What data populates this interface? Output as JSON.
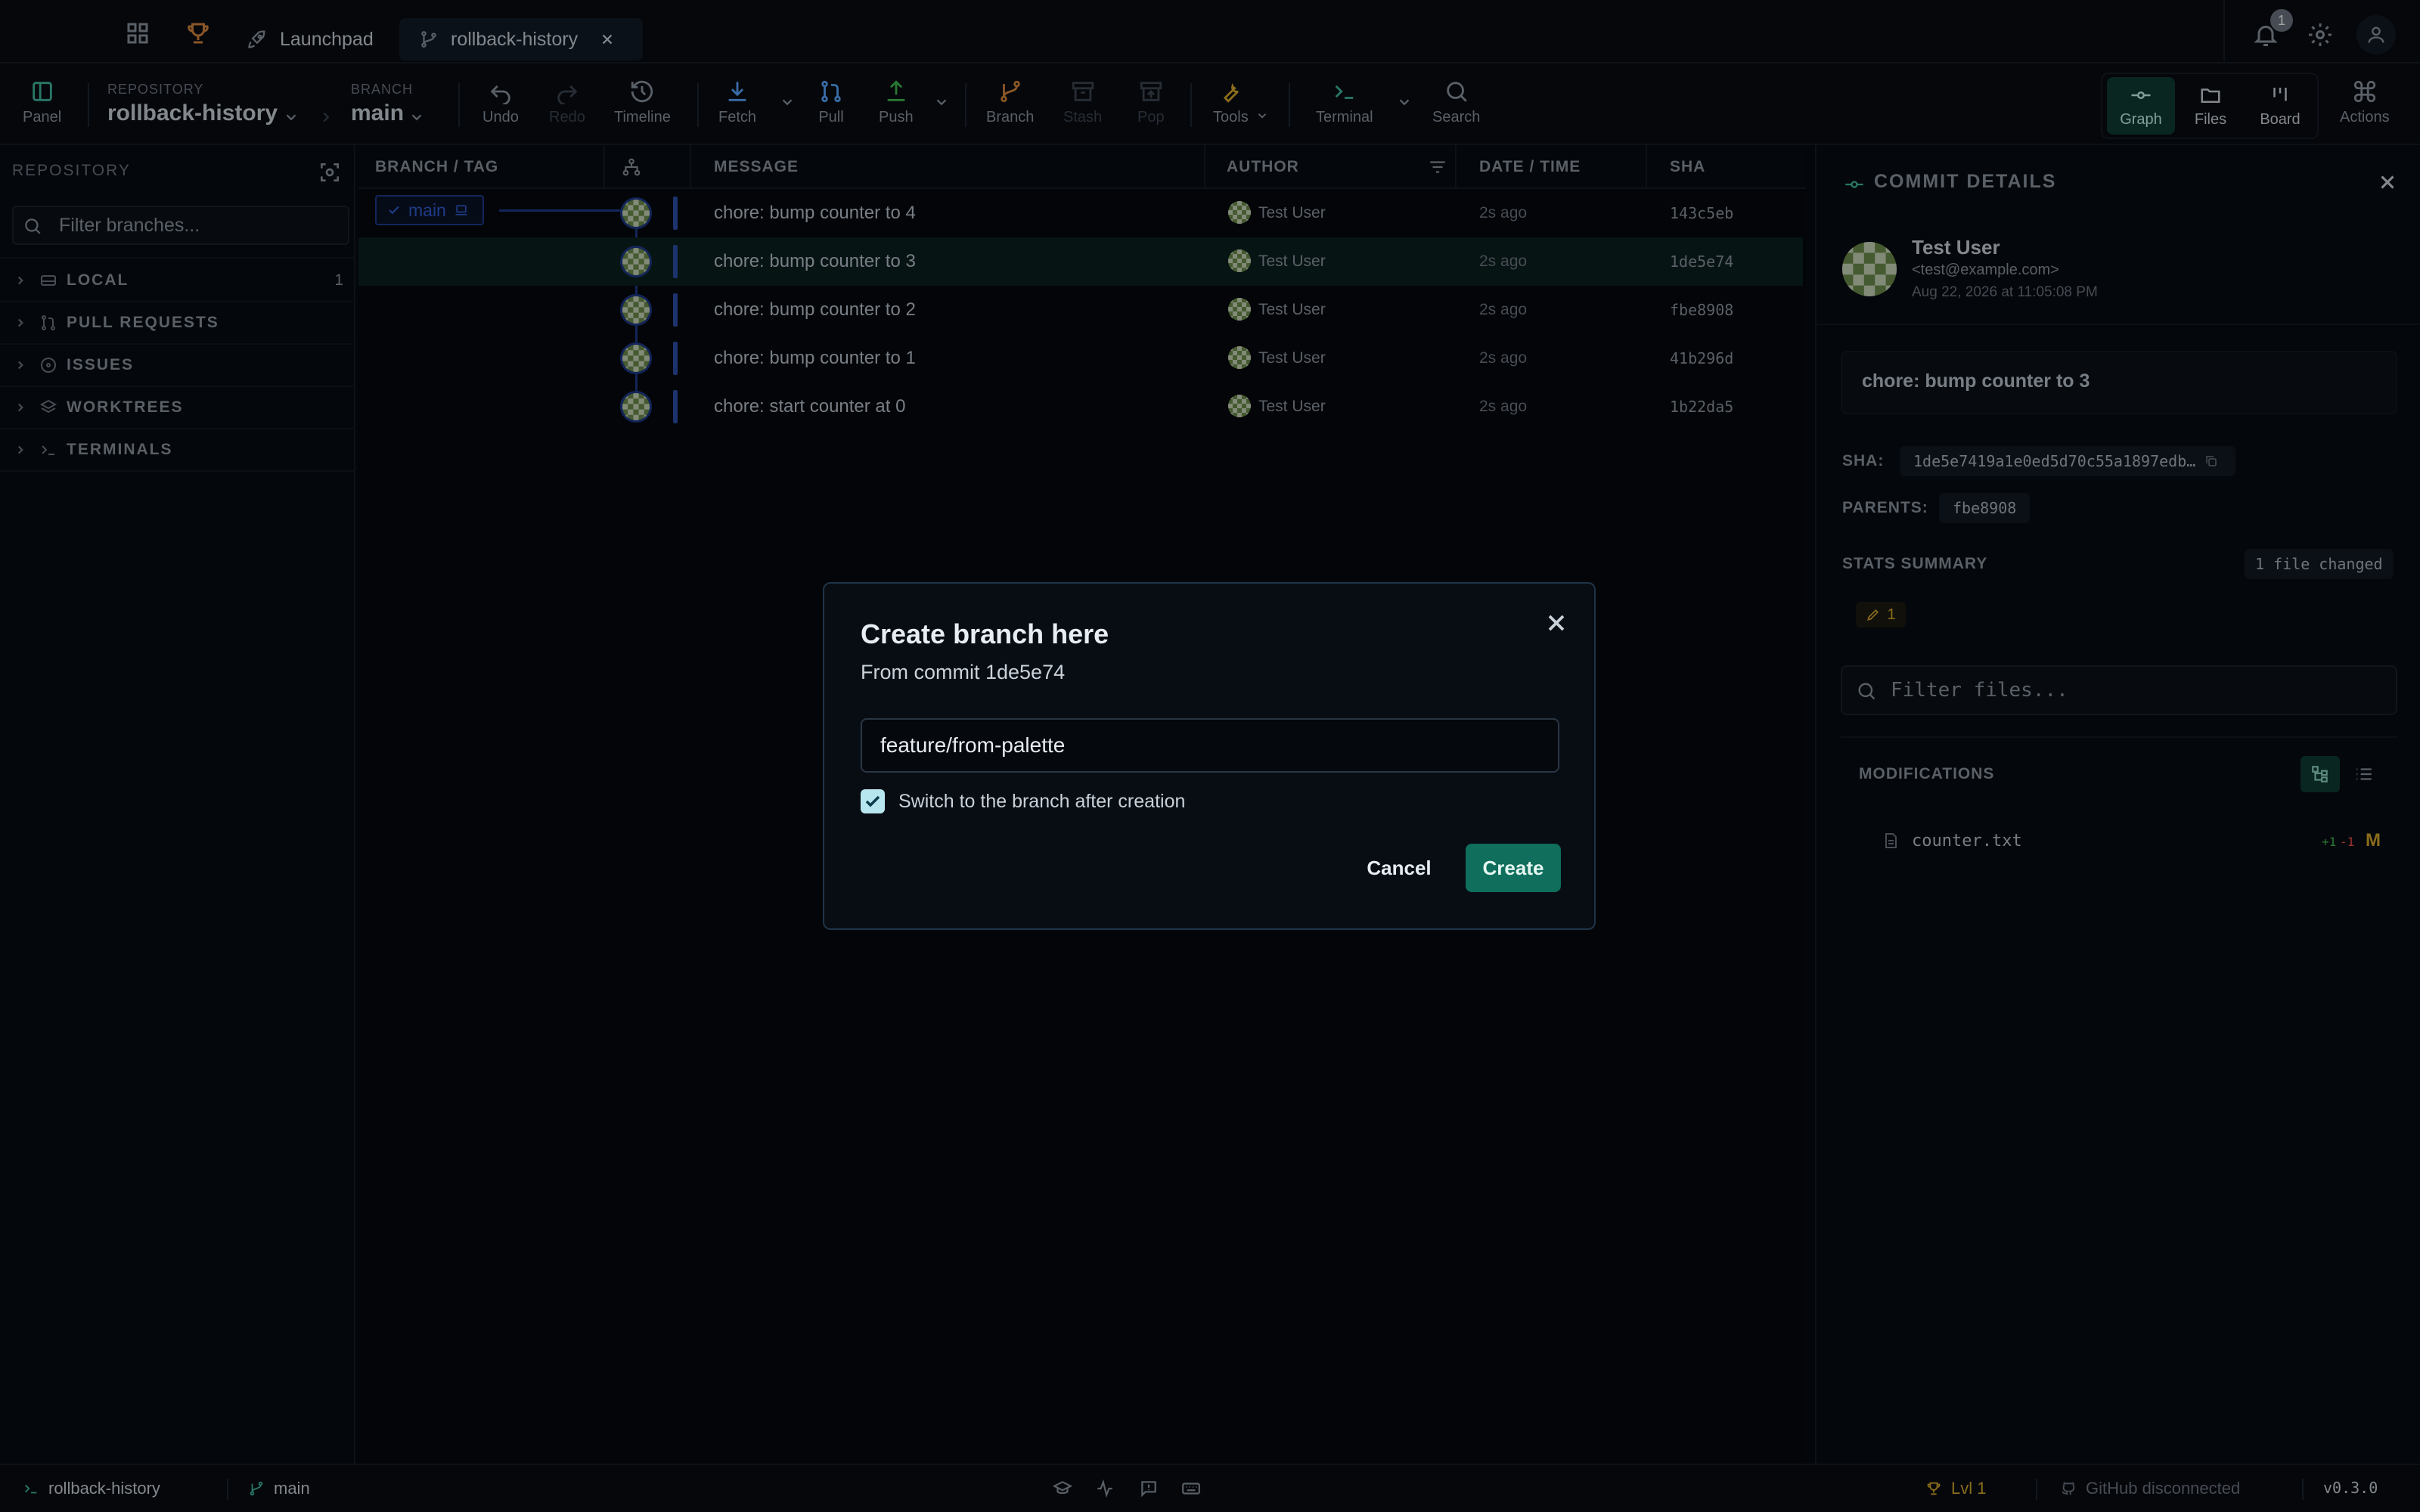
{
  "tabs": {
    "launchpad_label": "Launchpad",
    "repo_tab_label": "rollback-history",
    "notification_count": "1"
  },
  "toolbar": {
    "panel_label": "Panel",
    "repository_caption": "REPOSITORY",
    "repository_name": "rollback-history",
    "branch_caption": "BRANCH",
    "branch_name": "main",
    "undo": "Undo",
    "redo": "Redo",
    "timeline": "Timeline",
    "fetch": "Fetch",
    "pull": "Pull",
    "push": "Push",
    "branch": "Branch",
    "stash": "Stash",
    "pop": "Pop",
    "tools": "Tools",
    "terminal": "Terminal",
    "search": "Search",
    "graph": "Graph",
    "files": "Files",
    "board": "Board",
    "actions": "Actions"
  },
  "sidebar": {
    "title": "REPOSITORY",
    "filter_placeholder": "Filter branches...",
    "items": [
      {
        "label": "LOCAL",
        "count": "1"
      },
      {
        "label": "PULL REQUESTS",
        "count": ""
      },
      {
        "label": "ISSUES",
        "count": ""
      },
      {
        "label": "WORKTREES",
        "count": ""
      },
      {
        "label": "TERMINALS",
        "count": ""
      }
    ]
  },
  "graph": {
    "columns": {
      "branch_tag": "BRANCH / TAG",
      "message": "MESSAGE",
      "author": "AUTHOR",
      "date_time": "DATE / TIME",
      "sha": "SHA"
    },
    "branch_label": "main",
    "commits": [
      {
        "message": "chore: bump counter to 4",
        "author": "Test User",
        "date": "2s ago",
        "sha": "143c5eb"
      },
      {
        "message": "chore: bump counter to 3",
        "author": "Test User",
        "date": "2s ago",
        "sha": "1de5e74"
      },
      {
        "message": "chore: bump counter to 2",
        "author": "Test User",
        "date": "2s ago",
        "sha": "fbe8908"
      },
      {
        "message": "chore: bump counter to 1",
        "author": "Test User",
        "date": "2s ago",
        "sha": "41b296d"
      },
      {
        "message": "chore: start counter at 0",
        "author": "Test User",
        "date": "2s ago",
        "sha": "1b22da5"
      }
    ],
    "selected_index": 1
  },
  "details": {
    "title": "COMMIT DETAILS",
    "author_name": "Test User",
    "author_email": "<test@example.com>",
    "author_date": "Aug 22, 2026 at 11:05:08 PM",
    "commit_message": "chore: bump counter to 3",
    "sha_label": "SHA:",
    "sha_value": "1de5e7419a1e0ed5d70c55a1897edb…",
    "parents_label": "PARENTS:",
    "parent_sha": "fbe8908",
    "stats_label": "STATS SUMMARY",
    "files_changed": "1 file changed",
    "modified_count": "1",
    "filter_placeholder": "Filter files...",
    "modifications_label": "MODIFICATIONS",
    "files": [
      {
        "name": "counter.txt",
        "additions": "+1",
        "deletions": "-1",
        "status": "M"
      }
    ]
  },
  "statusbar": {
    "repo": "rollback-history",
    "branch": "main",
    "level": "Lvl 1",
    "github": "GitHub disconnected",
    "version": "v0.3.0"
  },
  "modal": {
    "title": "Create branch here",
    "subtitle": "From commit 1de5e74",
    "input_value": "feature/from-palette",
    "checkbox_label": "Switch to the branch after creation",
    "checkbox_checked": true,
    "cancel_label": "Cancel",
    "create_label": "Create"
  },
  "colors": {
    "accent": "#0f6e5c",
    "lane": "#2b4fa8",
    "warning": "#d4a72c",
    "add": "#3fb950",
    "del": "#f85149"
  }
}
